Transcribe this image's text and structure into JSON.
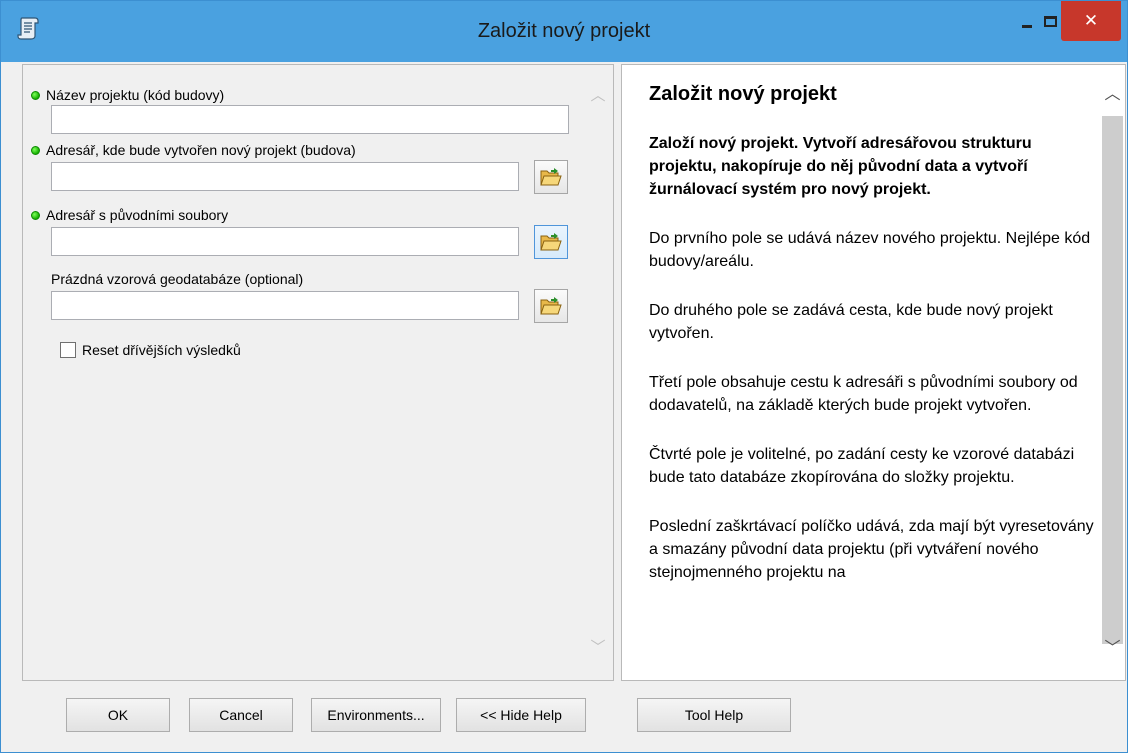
{
  "window": {
    "title": "Založit nový projekt",
    "close_glyph": "✕"
  },
  "form": {
    "fields": [
      {
        "label": "Název projektu (kód budovy)",
        "required": true,
        "value": ""
      },
      {
        "label": "Adresář, kde bude vytvořen nový projekt (budova)",
        "required": true,
        "value": ""
      },
      {
        "label": "Adresář s původními soubory",
        "required": true,
        "value": ""
      },
      {
        "label": "Prázdná vzorová geodatabáze (optional)",
        "required": false,
        "value": ""
      }
    ],
    "checkbox_label": "Reset dřívějších výsledků",
    "checkbox_checked": false
  },
  "help": {
    "title": "Založit nový projekt",
    "summary": "Založí nový projekt. Vytvoří adresářovou strukturu projektu, nakopíruje do něj původní data a vytvoří žurnálovací systém pro nový projekt.",
    "paragraphs": [
      "Do prvního pole se udává název nového projektu. Nejlépe kód budovy/areálu.",
      "Do druhého pole se zadává cesta, kde bude nový projekt vytvořen.",
      "Třetí pole obsahuje cestu k adresáři s původními soubory od dodavatelů, na základě kterých bude projekt vytvořen.",
      "Čtvrté pole je volitelné, po zadání cesty ke vzorové databázi bude tato databáze zkopírována do složky projektu.",
      "Poslední zaškrtávací políčko udává, zda mají být vyresetovány a smazány původní data projektu (při vytváření nového stejnojmenného projektu na"
    ]
  },
  "buttons": {
    "ok": "OK",
    "cancel": "Cancel",
    "environments": "Environments...",
    "hide_help": "<< Hide Help",
    "tool_help": "Tool Help"
  },
  "icons": {
    "app": "toolbox-script-icon",
    "browse": "folder-open-icon"
  },
  "colors": {
    "titlebar": "#4aa1e0",
    "close_button": "#c7372b",
    "required_dot": "#16b000"
  }
}
